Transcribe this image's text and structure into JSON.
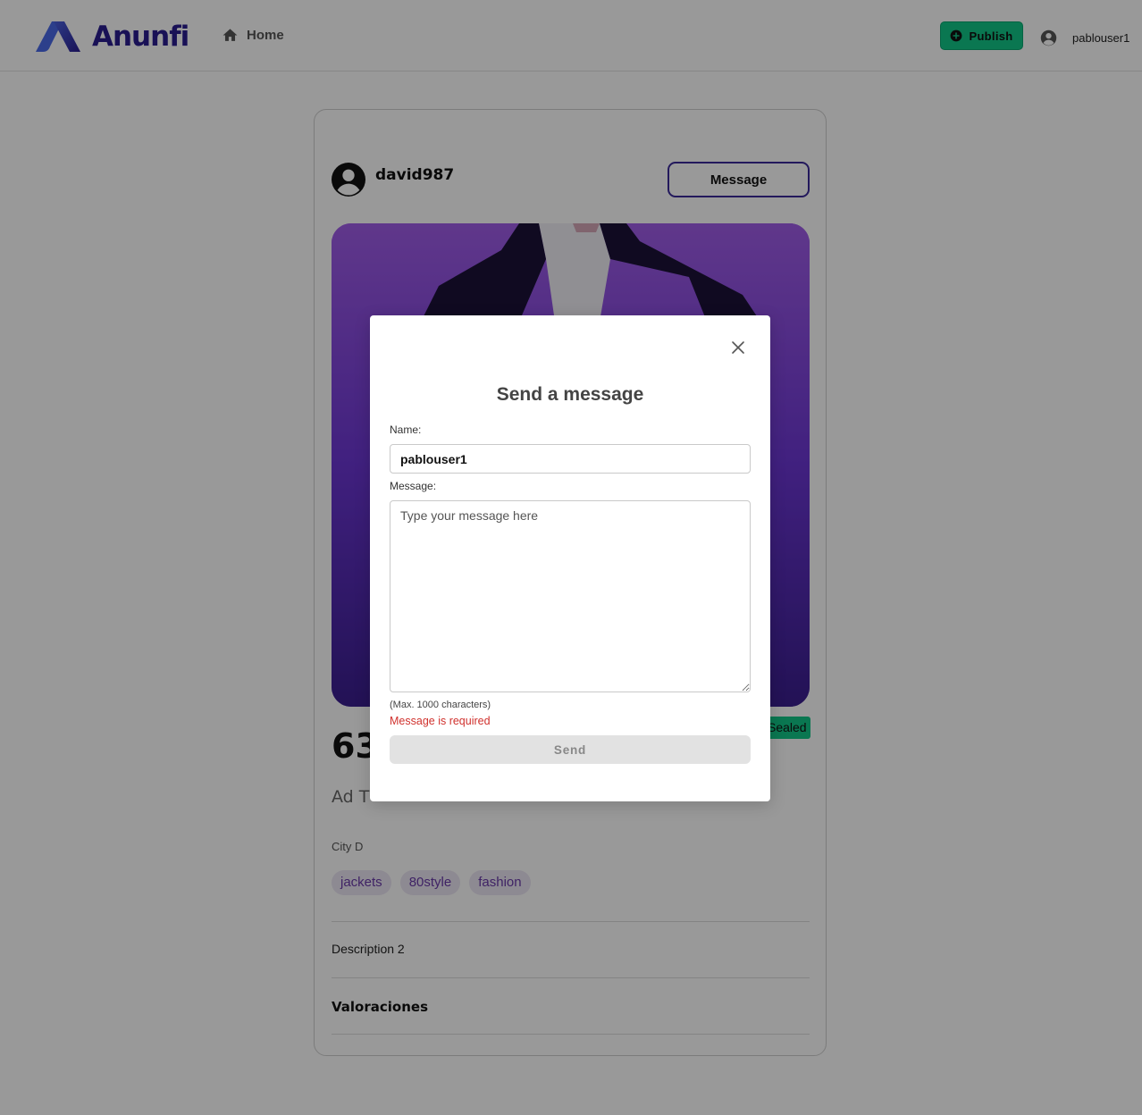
{
  "header": {
    "brand": "Anunfi",
    "nav_home": "Home",
    "publish_label": "Publish",
    "username": "pablouser1"
  },
  "listing": {
    "seller": "david987",
    "message_button": "Message",
    "price_partial": "63",
    "status_badge": "Sealed",
    "title_partial": "Ad T",
    "city": "City D",
    "tags": [
      "jackets",
      "80style",
      "fashion"
    ],
    "description": "Description 2",
    "ratings_heading": "Valoraciones"
  },
  "modal": {
    "title": "Send a message",
    "name_label": "Name:",
    "name_value": "pablouser1",
    "message_label": "Message:",
    "message_placeholder": "Type your message here",
    "max_note": "(Max. 1000 characters)",
    "error": "Message is required",
    "send_label": "Send"
  },
  "colors": {
    "brand": "#2a1d8f",
    "publish_green": "#11c787",
    "error_red": "#d0312d",
    "tag_text": "#6a3aa8"
  }
}
